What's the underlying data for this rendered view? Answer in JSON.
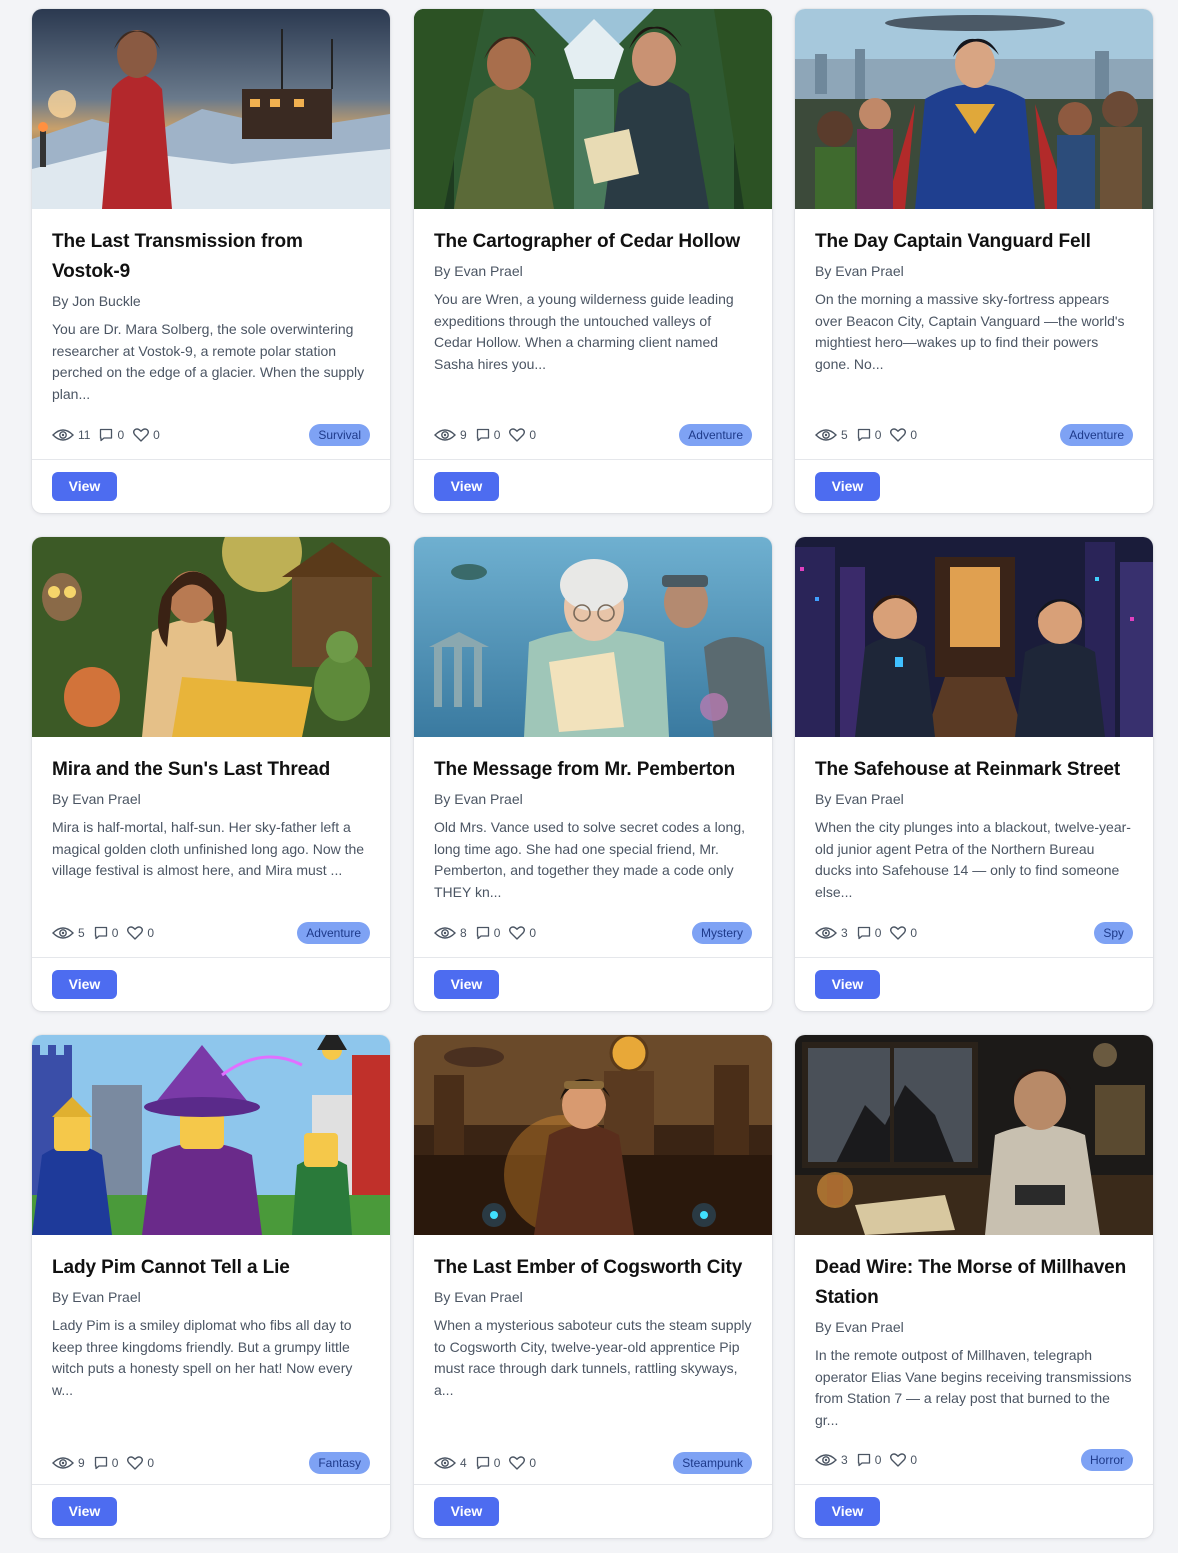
{
  "cards": [
    {
      "title": "The Last Transmission from Vostok-9",
      "author": "By Jon Buckle",
      "description": "You are Dr. Mara Solberg, the sole overwintering researcher at Vostok-9, a remote polar station perched on the edge of a glacier. When the supply plan...",
      "views": "11",
      "comments": "0",
      "likes": "0",
      "tag": "Survival",
      "button": "View",
      "image": "polar-research-station-illustration"
    },
    {
      "title": "The Cartographer of Cedar Hollow",
      "author": "By Evan Prael",
      "description": "You are Wren, a young wilderness guide leading expeditions through the untouched valleys of Cedar Hollow. When a charming client named Sasha hires you...",
      "views": "9",
      "comments": "0",
      "likes": "0",
      "tag": "Adventure",
      "button": "View",
      "image": "forest-hikers-illustration"
    },
    {
      "title": "The Day Captain Vanguard Fell",
      "author": "By Evan Prael",
      "description": "On the morning a massive sky-fortress appears over Beacon City, Captain Vanguard —the world's mightiest hero—wakes up to find their powers gone. No...",
      "views": "5",
      "comments": "0",
      "likes": "0",
      "tag": "Adventure",
      "button": "View",
      "image": "superhero-crowd-illustration"
    },
    {
      "title": "Mira and the Sun's Last Thread",
      "author": "By Evan Prael",
      "description": "Mira is half-mortal, half-sun. Her sky-father left a magical golden cloth unfinished long ago. Now the village festival is almost here, and Mira must ...",
      "views": "5",
      "comments": "0",
      "likes": "0",
      "tag": "Adventure",
      "button": "View",
      "image": "girl-weaving-golden-cloth-illustration"
    },
    {
      "title": "The Message from Mr. Pemberton",
      "author": "By Evan Prael",
      "description": "Old Mrs. Vance used to solve secret codes a long, long time ago. She had one special friend, Mr. Pemberton, and together they made a code only THEY kn...",
      "views": "8",
      "comments": "0",
      "likes": "0",
      "tag": "Mystery",
      "button": "View",
      "image": "woman-reading-letter-underwater-illustration"
    },
    {
      "title": "The Safehouse at Reinmark Street",
      "author": "By Evan Prael",
      "description": "When the city plunges into a blackout, twelve-year-old junior agent Petra of the Northern Bureau ducks into Safehouse 14 — only to find someone else...",
      "views": "3",
      "comments": "0",
      "likes": "0",
      "tag": "Spy",
      "button": "View",
      "image": "pixel-art-night-city-agents"
    },
    {
      "title": "Lady Pim Cannot Tell a Lie",
      "author": "By Evan Prael",
      "description": "Lady Pim is a smiley diplomat who fibs all day to keep three kingdoms friendly. But a grumpy little witch puts a honesty spell on her hat! Now every w...",
      "views": "9",
      "comments": "0",
      "likes": "0",
      "tag": "Fantasy",
      "button": "View",
      "image": "toy-brick-kingdom-illustration"
    },
    {
      "title": "The Last Ember of Cogsworth City",
      "author": "By Evan Prael",
      "description": "When a mysterious saboteur cuts the steam supply to Cogsworth City, twelve-year-old apprentice Pip must race through dark tunnels, rattling skyways, a...",
      "views": "4",
      "comments": "0",
      "likes": "0",
      "tag": "Steampunk",
      "button": "View",
      "image": "steampunk-city-illustration"
    },
    {
      "title": "Dead Wire: The Morse of Millhaven Station",
      "author": "By Evan Prael",
      "description": "In the remote outpost of Millhaven, telegraph operator Elias Vane begins receiving transmissions from Station 7 — a relay post that burned to the gr...",
      "views": "3",
      "comments": "0",
      "likes": "0",
      "tag": "Horror",
      "button": "View",
      "image": "telegraph-operator-illustration"
    }
  ]
}
